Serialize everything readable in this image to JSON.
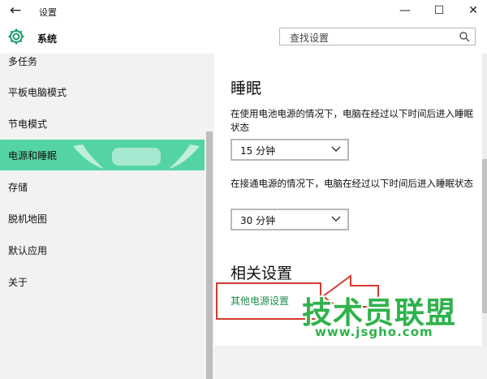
{
  "window": {
    "title": "设置",
    "back_icon": "back-arrow-icon",
    "minimize_glyph": "—",
    "maximize_glyph": "☐",
    "close_glyph": "✕"
  },
  "header": {
    "title": "系统",
    "icon": "gear-icon",
    "search_placeholder": "查找设置"
  },
  "sidebar": {
    "items": [
      {
        "label": "多任务"
      },
      {
        "label": "平板电脑模式"
      },
      {
        "label": "节电模式"
      },
      {
        "label": "电源和睡眠",
        "active": true
      },
      {
        "label": "存储"
      },
      {
        "label": "脱机地图"
      },
      {
        "label": "默认应用"
      },
      {
        "label": "关于"
      }
    ]
  },
  "content": {
    "sleep_heading": "睡眠",
    "battery_desc": "在使用电池电源的情况下，电脑在经过以下时间后进入睡眠状态",
    "battery_value": "15 分钟",
    "plugged_desc": "在接通电源的情况下，电脑在经过以下时间后进入睡眠状态",
    "plugged_value": "30 分钟",
    "related_heading": "相关设置",
    "power_link": "其他电源设置"
  },
  "watermark": {
    "main": "技术员联盟",
    "sub": "www.jsgho.com"
  },
  "colors": {
    "active_nav": "#54d4a4",
    "link": "#1e8c4c",
    "highlight": "#d53a2e",
    "watermark": "#2fb24c"
  }
}
